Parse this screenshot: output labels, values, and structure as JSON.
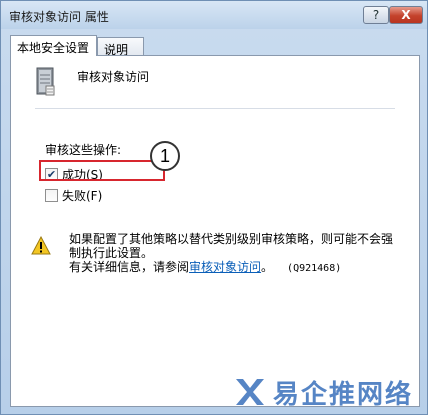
{
  "window": {
    "title": "审核对象访问 属性",
    "help_label": "?",
    "close_label": "X"
  },
  "tabs": [
    {
      "label": "本地安全设置",
      "active": true
    },
    {
      "label": "说明",
      "active": false
    }
  ],
  "policy": {
    "name": "审核对象访问",
    "icon": "server-icon"
  },
  "audit": {
    "section_label": "审核这些操作:",
    "success": {
      "label": "成功(S)",
      "checked": true
    },
    "failure": {
      "label": "失败(F)",
      "checked": false
    }
  },
  "annotation": {
    "callout_number": "1",
    "highlight_color": "#d7262e"
  },
  "warning": {
    "icon": "warning-icon",
    "line1": "如果配置了其他策略以替代类别级别审核策略，则可能不会强制执行此设置。",
    "more_prefix": "有关详细信息，请参阅",
    "link_text": "审核对象访问",
    "suffix": "。",
    "kb": "(Q921468)"
  },
  "watermark": {
    "text": "易企推网络"
  },
  "colors": {
    "link": "#0b5fb8",
    "close_button": "#c4422c",
    "watermark": "#2d67b7"
  }
}
